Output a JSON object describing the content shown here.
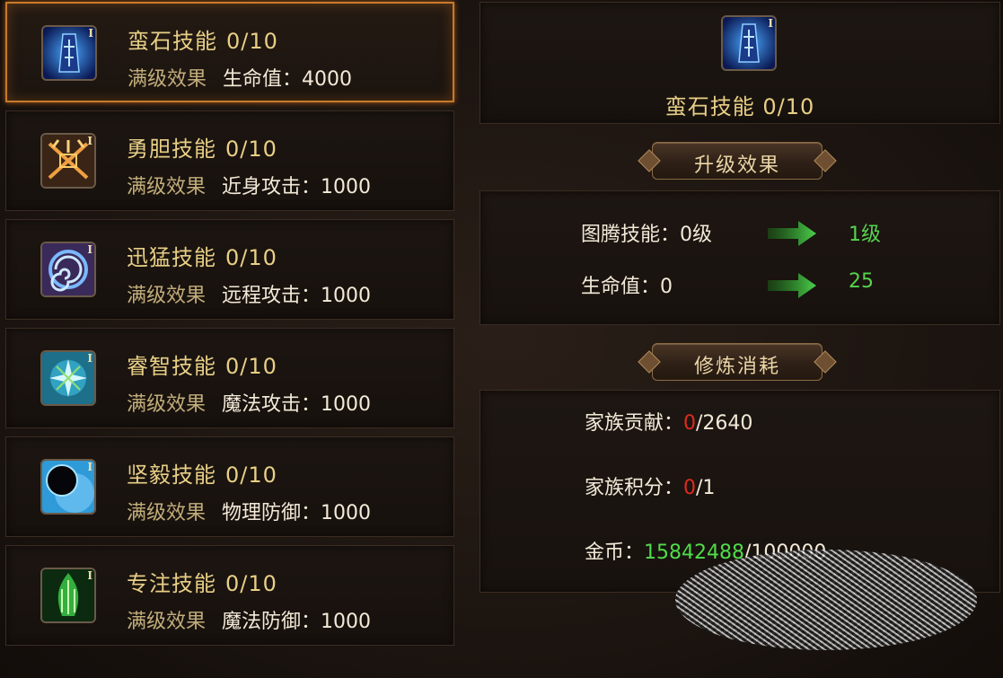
{
  "skills": [
    {
      "name": "蛮石技能",
      "level": "0/10",
      "effect_label": "满级效果",
      "effect_value": "生命值：4000",
      "icon": "stone-rune-icon",
      "selected": true
    },
    {
      "name": "勇胆技能",
      "level": "0/10",
      "effect_label": "满级效果",
      "effect_value": "近身攻击：1000",
      "icon": "crossed-blades-icon",
      "selected": false
    },
    {
      "name": "迅猛技能",
      "level": "0/10",
      "effect_label": "满级效果",
      "effect_value": "远程攻击：1000",
      "icon": "vortex-icon",
      "selected": false
    },
    {
      "name": "睿智技能",
      "level": "0/10",
      "effect_label": "满级效果",
      "effect_value": "魔法攻击：1000",
      "icon": "arcane-star-icon",
      "selected": false
    },
    {
      "name": "坚毅技能",
      "level": "0/10",
      "effect_label": "满级效果",
      "effect_value": "物理防御：1000",
      "icon": "dark-orb-icon",
      "selected": false
    },
    {
      "name": "专注技能",
      "level": "0/10",
      "effect_label": "满级效果",
      "effect_value": "魔法防御：1000",
      "icon": "green-flame-icon",
      "selected": false
    }
  ],
  "icon_tier": "I",
  "detail": {
    "title_name": "蛮石技能",
    "title_level": "0/10",
    "upgrade_header": "升级效果",
    "upgrade_rows": [
      {
        "label": "图腾技能：0级",
        "next": "1级"
      },
      {
        "label": "生命值：0",
        "next": "25"
      }
    ],
    "cost_header": "修炼消耗",
    "costs": [
      {
        "label": "家族贡献：",
        "current": "0",
        "required": "/2640",
        "status": "insufficient"
      },
      {
        "label": "家族积分：",
        "current": "0",
        "required": "/1",
        "status": "insufficient"
      },
      {
        "label": "金币：",
        "current": "15842488",
        "required": "/100000",
        "status": "sufficient"
      }
    ]
  },
  "colors": {
    "gold_text": "#e8cf86",
    "selected_border": "#c77a2a",
    "green": "#4fdc4a",
    "red": "#e02a1e"
  }
}
